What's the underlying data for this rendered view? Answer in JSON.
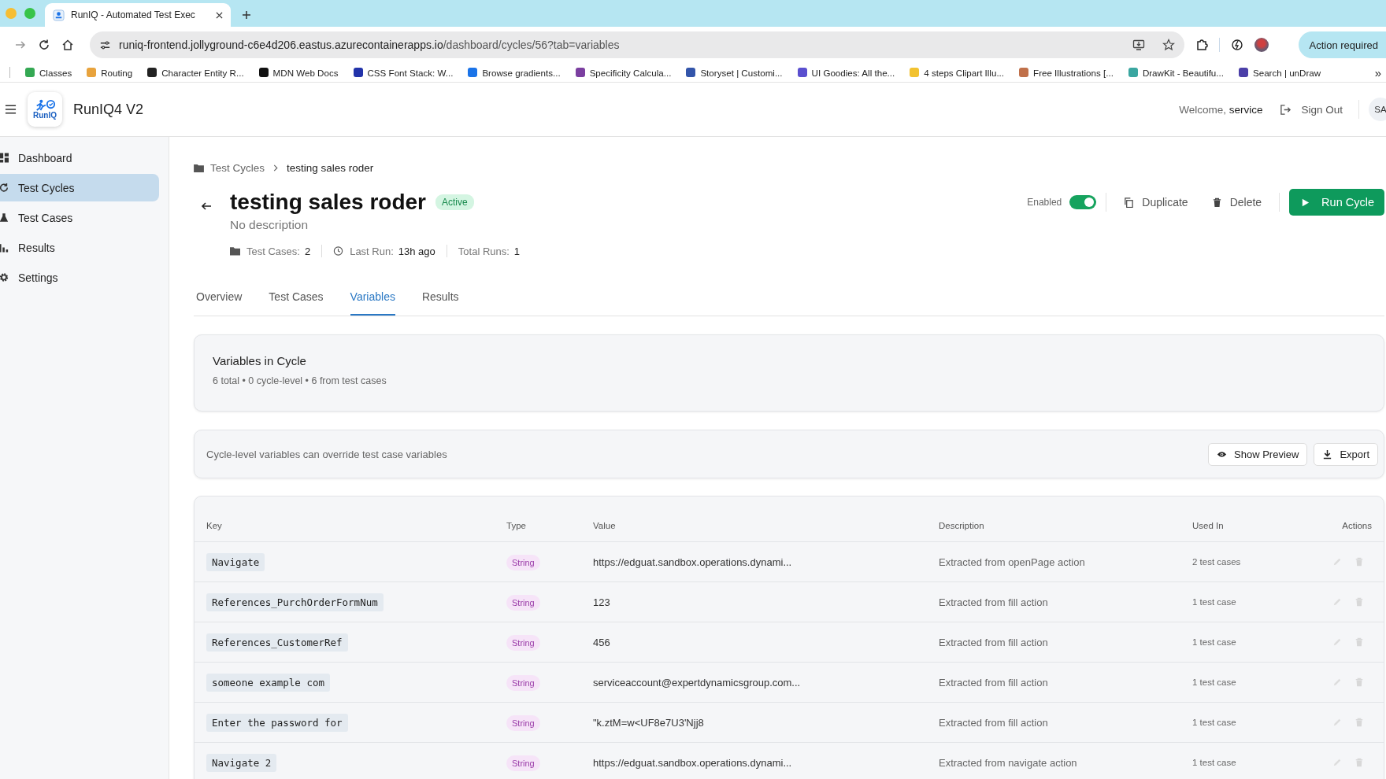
{
  "browser": {
    "tab_title": "RunIQ - Automated Test Exec",
    "url_host": "runiq-frontend.jollyground-c6e4d206.eastus.azurecontainerapps.io",
    "url_path": "/dashboard/cycles/56?tab=variables",
    "action_button": "Action required",
    "bookmarks": [
      {
        "label": "Classes",
        "color": "#34a853"
      },
      {
        "label": "Routing",
        "color": "#e8a33d"
      },
      {
        "label": "Character Entity R...",
        "color": "#222222"
      },
      {
        "label": "MDN Web Docs",
        "color": "#111111"
      },
      {
        "label": "CSS Font Stack: W...",
        "color": "#2233aa"
      },
      {
        "label": "Browse gradients...",
        "color": "#1a73e8"
      },
      {
        "label": "Specificity Calcula...",
        "color": "#7b3fa0"
      },
      {
        "label": "Storyset | Customi...",
        "color": "#3355aa"
      },
      {
        "label": "UI Goodies: All the...",
        "color": "#5a4fcf"
      },
      {
        "label": "4 steps Clipart Illu...",
        "color": "#f2c230"
      },
      {
        "label": "Free Illustrations [...",
        "color": "#c0704a"
      },
      {
        "label": "DrawKit - Beautifu...",
        "color": "#3aa6a0"
      },
      {
        "label": "Search | unDraw",
        "color": "#4b3fa8"
      }
    ],
    "more": "»"
  },
  "app": {
    "name": "RunIQ4 V2",
    "logo_text": "RunIQ",
    "welcome": "Welcome,",
    "user": "service",
    "sign_out": "Sign Out",
    "avatar": "SA"
  },
  "sidebar": {
    "items": [
      {
        "label": "Dashboard",
        "kind": "dashboard",
        "selected": false
      },
      {
        "label": "Test Cycles",
        "kind": "cycle",
        "selected": true
      },
      {
        "label": "Test Cases",
        "kind": "flask",
        "selected": false
      },
      {
        "label": "Results",
        "kind": "chart",
        "selected": false
      },
      {
        "label": "Settings",
        "kind": "gear",
        "selected": false
      }
    ]
  },
  "breadcrumb": {
    "parent": "Test Cycles",
    "current": "testing sales roder"
  },
  "cycle": {
    "title": "testing sales roder",
    "status": "Active",
    "description": "No description",
    "meta": [
      {
        "kind": "folder",
        "label": "Test Cases:",
        "value": "2"
      },
      {
        "kind": "clock",
        "label": "Last Run:",
        "value": "13h ago"
      },
      {
        "kind": "plain",
        "label": "Total Runs:",
        "value": "1"
      }
    ],
    "enabled": {
      "label": "Enabled",
      "on": true
    },
    "duplicate": "Duplicate",
    "delete": "Delete",
    "run": "Run Cycle"
  },
  "tabs": [
    {
      "label": "Overview",
      "selected": false
    },
    {
      "label": "Test Cases",
      "selected": false
    },
    {
      "label": "Variables",
      "selected": true
    },
    {
      "label": "Results",
      "selected": false
    }
  ],
  "variables_card": {
    "title": "Variables in Cycle",
    "summary": "6 total • 0 cycle-level • 6 from test cases"
  },
  "notice": {
    "text": "Cycle-level variables can override test case variables",
    "preview": "Show Preview",
    "export": "Export"
  },
  "table": {
    "columns": [
      "Key",
      "Type",
      "Value",
      "Description",
      "Used In",
      "Actions"
    ],
    "rows": [
      {
        "key": "Navigate",
        "type": "String",
        "value": "https://edguat.sandbox.operations.dynami...",
        "description": "Extracted from openPage action",
        "used_in": "2 test cases"
      },
      {
        "key": "References_PurchOrderFormNum",
        "type": "String",
        "value": "123",
        "description": "Extracted from fill action",
        "used_in": "1 test case"
      },
      {
        "key": "References_CustomerRef",
        "type": "String",
        "value": "456",
        "description": "Extracted from fill action",
        "used_in": "1 test case"
      },
      {
        "key": "someone example com",
        "type": "String",
        "value": "serviceaccount@expertdynamicsgroup.com...",
        "description": "Extracted from fill action",
        "used_in": "1 test case"
      },
      {
        "key": "Enter the password for",
        "type": "String",
        "value": "\"k.ztM=w<UF8e7U3'Njj8",
        "description": "Extracted from fill action",
        "used_in": "1 test case"
      },
      {
        "key": "Navigate 2",
        "type": "String",
        "value": "https://edguat.sandbox.operations.dynami...",
        "description": "Extracted from navigate action",
        "used_in": "1 test case"
      }
    ]
  }
}
